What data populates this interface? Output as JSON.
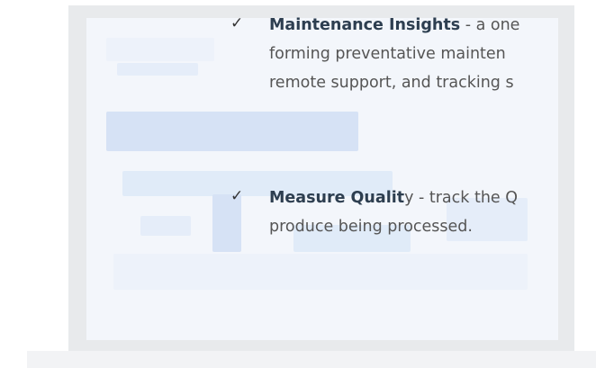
{
  "features": [
    {
      "term": "Maintenance Insights",
      "lines": [
        " - a one",
        "forming preventative mainten",
        "remote support, and tracking s"
      ]
    },
    {
      "term_bold": "Measure Qualit",
      "term_rest": "y",
      "lines": [
        " - track the Q",
        "produce being processed."
      ]
    }
  ],
  "check_icon": "check-mark-icon",
  "colors": {
    "term": "#2d3e50",
    "body_text": "#555555",
    "check": "#333333",
    "screen": "#f3f6fb",
    "bezel": "#e8eaec"
  }
}
